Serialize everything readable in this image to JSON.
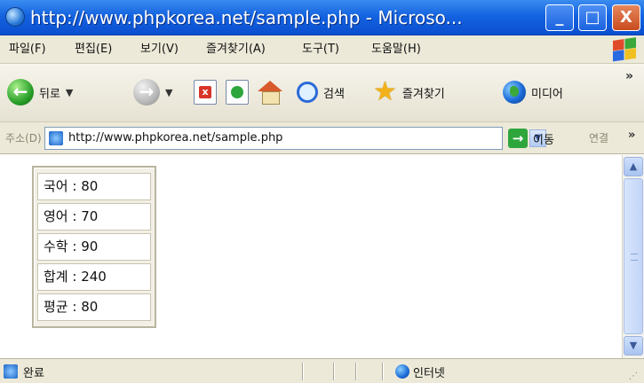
{
  "window": {
    "title": "http://www.phpkorea.net/sample.php - Microso...",
    "minimize": "_",
    "maximize": "□",
    "close": "X"
  },
  "menu": {
    "items": [
      "파일(F)",
      "편집(E)",
      "보기(V)",
      "즐겨찾기(A)",
      "도구(T)",
      "도움말(H)"
    ]
  },
  "toolbar": {
    "back_label": "뒤로",
    "search_label": "검색",
    "favorites_label": "즐겨찾기",
    "media_label": "미디어"
  },
  "address": {
    "label": "주소(D)",
    "url": "http://www.phpkorea.net/sample.php",
    "go_label": "이동",
    "links_label": "연결"
  },
  "scores": [
    {
      "text": "국어 : 80"
    },
    {
      "text": "영어 : 70"
    },
    {
      "text": "수학 : 90"
    },
    {
      "text": "합계 : 240"
    },
    {
      "text": "평균 : 80"
    }
  ],
  "status": {
    "left_text": "완료",
    "zone_text": "인터넷"
  }
}
